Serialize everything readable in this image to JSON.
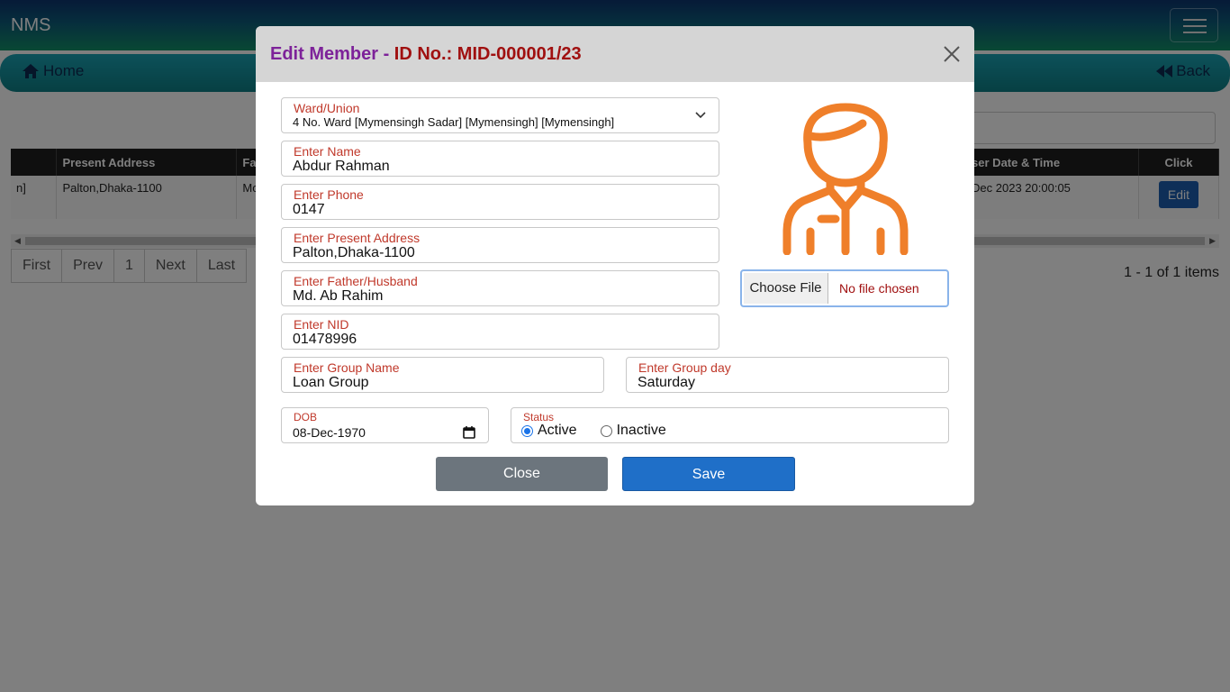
{
  "app": {
    "brand": "NMS"
  },
  "nav": {
    "home_label": "Home",
    "back_label": "Back"
  },
  "table": {
    "headers": [
      "Present Address",
      "Fa",
      "ser Date & Time",
      "Click"
    ],
    "row": {
      "partial_first": "n]",
      "present_address": "Palton,Dhaka-1100",
      "partial_father": "Mo",
      "date_time": "Dec 2023 20:00:05",
      "edit_label": "Edit"
    }
  },
  "pager": {
    "first": "First",
    "prev": "Prev",
    "page": "1",
    "next": "Next",
    "last": "Last",
    "items_info": "1 - 1 of 1 items"
  },
  "modal": {
    "title_prefix": "Edit Member - ",
    "title_id": "ID No.: MID-000001/23",
    "ward_label": "Ward/Union",
    "ward_value": "4 No. Ward [Mymensingh Sadar] [Mymensingh] [Mymensingh]",
    "name_label": "Enter Name",
    "name_value": "Abdur Rahman",
    "phone_label": "Enter Phone",
    "phone_value": "0147",
    "address_label": "Enter Present Address",
    "address_value": "Palton,Dhaka-1100",
    "father_label": "Enter Father/Husband",
    "father_value": "Md. Ab Rahim",
    "nid_label": "Enter NID",
    "nid_value": "01478996",
    "group_label": "Enter Group Name",
    "group_value": "Loan Group",
    "groupday_label": "Enter Group day",
    "groupday_value": "Saturday",
    "dob_label": "DOB",
    "dob_value": "08-Dec-1970",
    "status_label": "Status",
    "status_options": [
      "Active",
      "Inactive"
    ],
    "status_selected": "Active",
    "file_button": "Choose File",
    "file_status": "No file chosen",
    "close_label": "Close",
    "save_label": "Save"
  },
  "colors": {
    "title_purple": "#7d2299",
    "title_red": "#a01010",
    "label_red": "#c0392b",
    "avatar_orange": "#ef7f2a",
    "save_blue": "#1f6fc8",
    "close_gray": "#6c757d"
  }
}
